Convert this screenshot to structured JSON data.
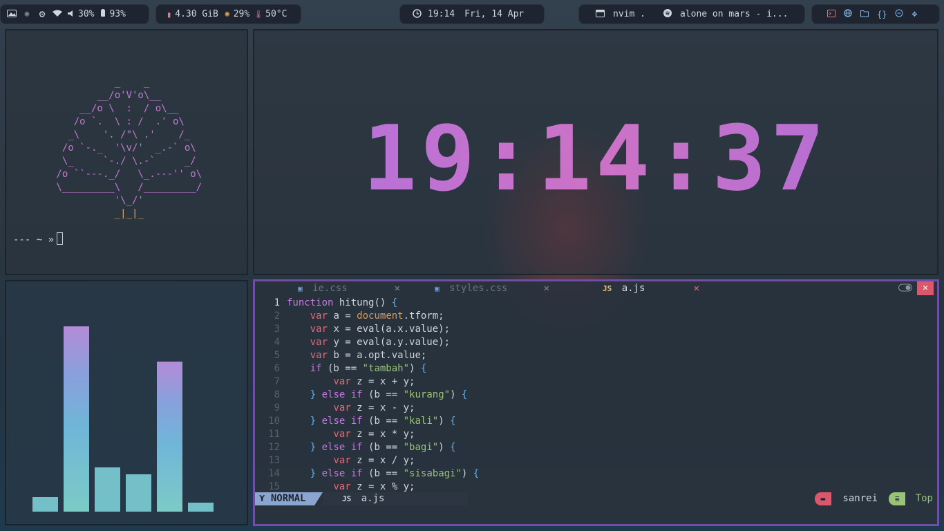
{
  "topbar": {
    "left": {
      "volume": "30%",
      "battery": "93%"
    },
    "system": {
      "memory": "4.30 GiB",
      "cpu": "29%",
      "temp": "50°C"
    },
    "clock": {
      "time": "19:14",
      "date": "Fri, 14 Apr"
    },
    "tasks": {
      "window": "nvim .",
      "music": "alone on mars - i..."
    }
  },
  "terminal": {
    "prompt": "--- ~ »"
  },
  "big_clock": {
    "h": "19",
    "m": "14",
    "s": "37"
  },
  "visualizer": {
    "levels": [
      0.08,
      1.0,
      0.24,
      0.2,
      0.81,
      0.05
    ]
  },
  "editor": {
    "tabs": [
      {
        "label": "ie.css",
        "icon": "css-icon"
      },
      {
        "label": "styles.css",
        "icon": "css-icon"
      },
      {
        "label": "a.js",
        "icon": "js-icon",
        "badge": "JS"
      }
    ],
    "line_numbers": [
      "1",
      "2",
      "3",
      "4",
      "5",
      "6",
      "7",
      "8",
      "9",
      "10",
      "11",
      "12",
      "13",
      "14",
      "15"
    ],
    "code": [
      "function hitung() {",
      "    var a = document.tform;",
      "    var x = eval(a.x.value);",
      "    var y = eval(a.y.value);",
      "    var b = a.opt.value;",
      "    if (b == \"tambah\") {",
      "        var z = x + y;",
      "    } else if (b == \"kurang\") {",
      "        var z = x - y;",
      "    } else if (b == \"kali\") {",
      "        var z = x * y;",
      "    } else if (b == \"bagi\") {",
      "        var z = x / y;",
      "    } else if (b == \"sisabagi\") {",
      "        var z = x % y;"
    ],
    "statusline": {
      "mode": "NORMAL",
      "file_badge": "JS",
      "file": "a.js",
      "cwd": "sanrei",
      "position": "Top"
    }
  },
  "colors": {
    "accent_purple": "#bf74d2",
    "accent_cyan": "#63c0c8",
    "editor_border": "#6f4ea6"
  }
}
